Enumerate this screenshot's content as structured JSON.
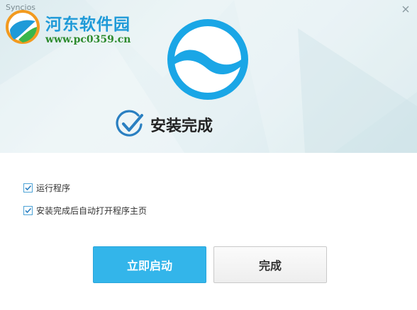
{
  "window": {
    "title": "Syncios"
  },
  "watermark": {
    "site_name": "河东软件园",
    "url": "www.pc0359.cn"
  },
  "status": {
    "message": "安装完成"
  },
  "options": [
    {
      "label": "运行程序",
      "checked": true
    },
    {
      "label": "安装完成后自动打开程序主页",
      "checked": true
    }
  ],
  "buttons": {
    "launch_label": "立即启动",
    "finish_label": "完成"
  },
  "colors": {
    "accent": "#33b5ea",
    "brand_blue": "#1aa6e6",
    "check_blue": "#2a7fc1"
  },
  "icons": {
    "close": "close-icon",
    "app_logo": "syncios-logo-icon",
    "status": "check-circle-icon",
    "checkbox": "checkmark-icon"
  }
}
